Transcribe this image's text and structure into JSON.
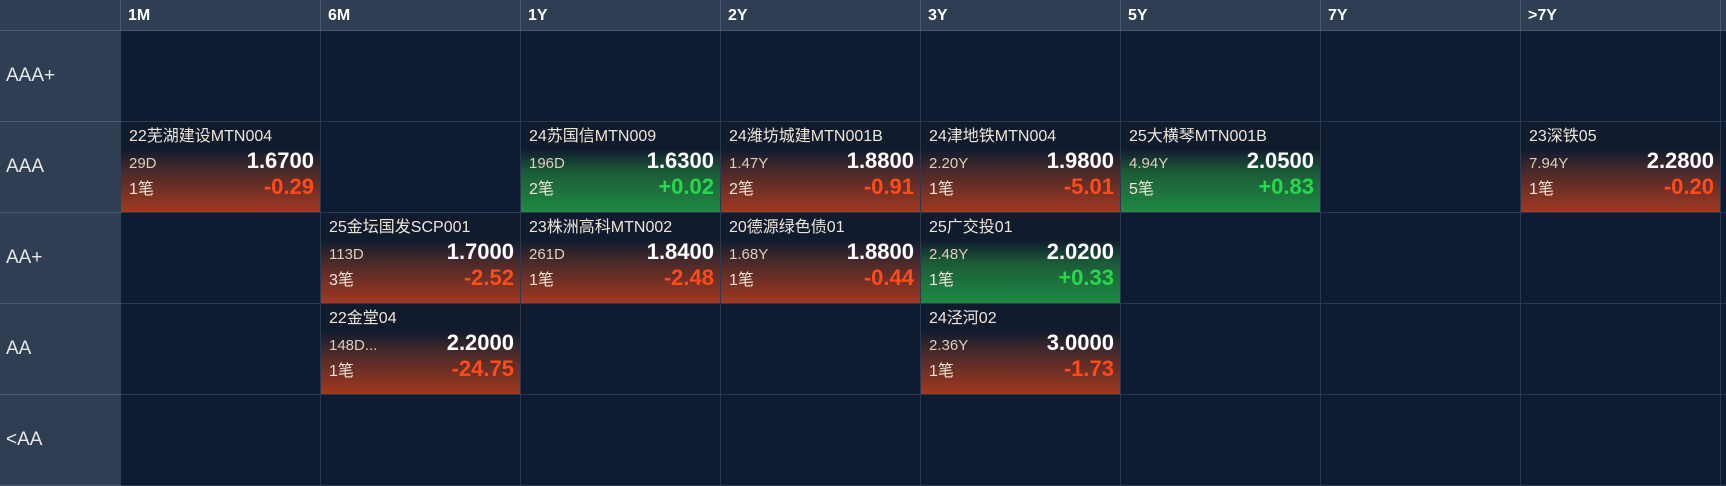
{
  "columns": [
    "1M",
    "6M",
    "1Y",
    "2Y",
    "3Y",
    "5Y",
    "7Y",
    ">7Y"
  ],
  "rows": [
    "AAA+",
    "AAA",
    "AA+",
    "AA",
    "<AA"
  ],
  "colors": {
    "up": "#1f8a43",
    "down": "#a2381f",
    "background": "#0f1b30",
    "header": "#2f3e52"
  },
  "cells": [
    {
      "row": 1,
      "col": 0,
      "name": "22芜湖建设MTN004",
      "term": "29D",
      "yield": "1.6700",
      "count": "1笔",
      "change": "-0.29",
      "direction": "down"
    },
    {
      "row": 1,
      "col": 2,
      "name": "24苏国信MTN009",
      "term": "196D",
      "yield": "1.6300",
      "count": "2笔",
      "change": "+0.02",
      "direction": "up"
    },
    {
      "row": 1,
      "col": 3,
      "name": "24潍坊城建MTN001B",
      "term": "1.47Y",
      "yield": "1.8800",
      "count": "2笔",
      "change": "-0.91",
      "direction": "down"
    },
    {
      "row": 1,
      "col": 4,
      "name": "24津地铁MTN004",
      "term": "2.20Y",
      "yield": "1.9800",
      "count": "1笔",
      "change": "-5.01",
      "direction": "down"
    },
    {
      "row": 1,
      "col": 5,
      "name": "25大横琴MTN001B",
      "term": "4.94Y",
      "yield": "2.0500",
      "count": "5笔",
      "change": "+0.83",
      "direction": "up"
    },
    {
      "row": 1,
      "col": 7,
      "name": "23深铁05",
      "term": "7.94Y",
      "yield": "2.2800",
      "count": "1笔",
      "change": "-0.20",
      "direction": "down"
    },
    {
      "row": 2,
      "col": 1,
      "name": "25金坛国发SCP001",
      "term": "113D",
      "yield": "1.7000",
      "count": "3笔",
      "change": "-2.52",
      "direction": "down"
    },
    {
      "row": 2,
      "col": 2,
      "name": "23株洲高科MTN002",
      "term": "261D",
      "yield": "1.8400",
      "count": "1笔",
      "change": "-2.48",
      "direction": "down"
    },
    {
      "row": 2,
      "col": 3,
      "name": "20德源绿色债01",
      "term": "1.68Y",
      "yield": "1.8800",
      "count": "1笔",
      "change": "-0.44",
      "direction": "down"
    },
    {
      "row": 2,
      "col": 4,
      "name": "25广交投01",
      "term": "2.48Y",
      "yield": "2.0200",
      "count": "1笔",
      "change": "+0.33",
      "direction": "up"
    },
    {
      "row": 3,
      "col": 1,
      "name": "22金堂04",
      "term": "148D...",
      "yield": "2.2000",
      "count": "1笔",
      "change": "-24.75",
      "direction": "down"
    },
    {
      "row": 3,
      "col": 4,
      "name": "24泾河02",
      "term": "2.36Y",
      "yield": "3.0000",
      "count": "1笔",
      "change": "-1.73",
      "direction": "down"
    }
  ]
}
